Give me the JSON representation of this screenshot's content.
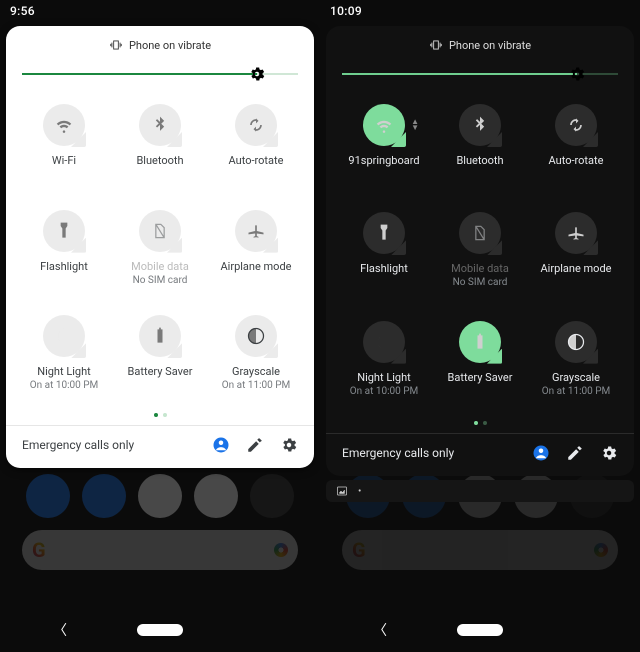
{
  "left": {
    "time": "9:56",
    "vibrate_label": "Phone on vibrate",
    "slider_pct": 85,
    "tiles": [
      {
        "label": "Wi-Fi",
        "sub": "",
        "on": false,
        "icon": "wifi"
      },
      {
        "label": "Bluetooth",
        "sub": "",
        "on": false,
        "icon": "bluetooth"
      },
      {
        "label": "Auto-rotate",
        "sub": "",
        "on": false,
        "icon": "rotate"
      },
      {
        "label": "Flashlight",
        "sub": "",
        "on": false,
        "icon": "flashlight"
      },
      {
        "label": "Mobile data",
        "sub": "No SIM card",
        "on": false,
        "icon": "nosim",
        "disabled": true
      },
      {
        "label": "Airplane mode",
        "sub": "",
        "on": false,
        "icon": "airplane"
      },
      {
        "label": "Night Light",
        "sub": "On at 10:00 PM",
        "on": false,
        "icon": "moon"
      },
      {
        "label": "Battery Saver",
        "sub": "",
        "on": false,
        "icon": "battery"
      },
      {
        "label": "Grayscale",
        "sub": "On at 11:00 PM",
        "on": false,
        "icon": "contrast"
      }
    ],
    "carrier": "Emergency calls only"
  },
  "right": {
    "time": "10:09",
    "vibrate_label": "Phone on vibrate",
    "slider_pct": 85,
    "tiles": [
      {
        "label": "91springboard",
        "sub": "",
        "on": true,
        "icon": "wifi",
        "expand": true
      },
      {
        "label": "Bluetooth",
        "sub": "",
        "on": false,
        "icon": "bluetooth"
      },
      {
        "label": "Auto-rotate",
        "sub": "",
        "on": false,
        "icon": "rotate"
      },
      {
        "label": "Flashlight",
        "sub": "",
        "on": false,
        "icon": "flashlight"
      },
      {
        "label": "Mobile data",
        "sub": "No SIM card",
        "on": false,
        "icon": "nosim",
        "disabled": true
      },
      {
        "label": "Airplane mode",
        "sub": "",
        "on": false,
        "icon": "airplane"
      },
      {
        "label": "Night Light",
        "sub": "On at 10:00 PM",
        "on": false,
        "icon": "moon"
      },
      {
        "label": "Battery Saver",
        "sub": "",
        "on": true,
        "icon": "battery"
      },
      {
        "label": "Grayscale",
        "sub": "On at 11:00 PM",
        "on": false,
        "icon": "contrast"
      }
    ],
    "carrier": "Emergency calls only",
    "mini_notif_top": 480
  },
  "colors": {
    "accent_light": "#1b873f",
    "accent_dark": "#7edc9c"
  }
}
